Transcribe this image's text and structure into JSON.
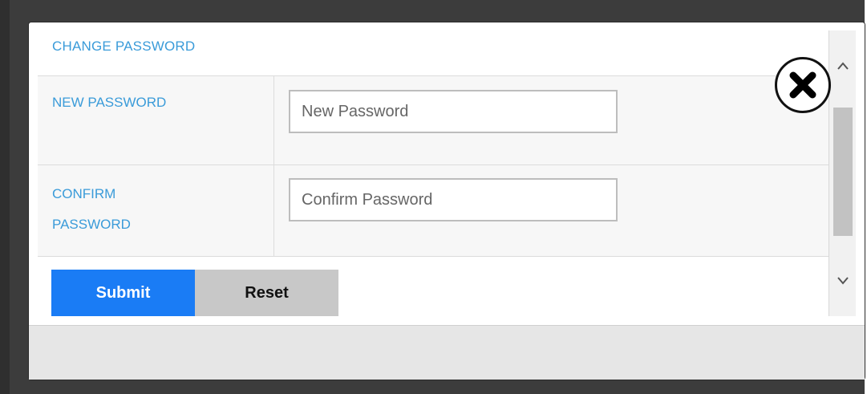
{
  "dialog": {
    "title": "CHANGE PASSWORD",
    "close_icon": "close-icon"
  },
  "form": {
    "new_password": {
      "label": "NEW PASSWORD",
      "placeholder": "New Password",
      "value": ""
    },
    "confirm_password": {
      "label": "CONFIRM PASSWORD",
      "placeholder": "Confirm Password",
      "value": ""
    },
    "submit_label": "Submit",
    "reset_label": "Reset"
  },
  "scrollbar": {
    "up_icon": "chevron-up-icon",
    "down_icon": "chevron-down-icon"
  },
  "colors": {
    "accent_blue": "#3a9bd9",
    "submit_bg": "#1a7cf5",
    "reset_bg": "#c8c8c8"
  }
}
